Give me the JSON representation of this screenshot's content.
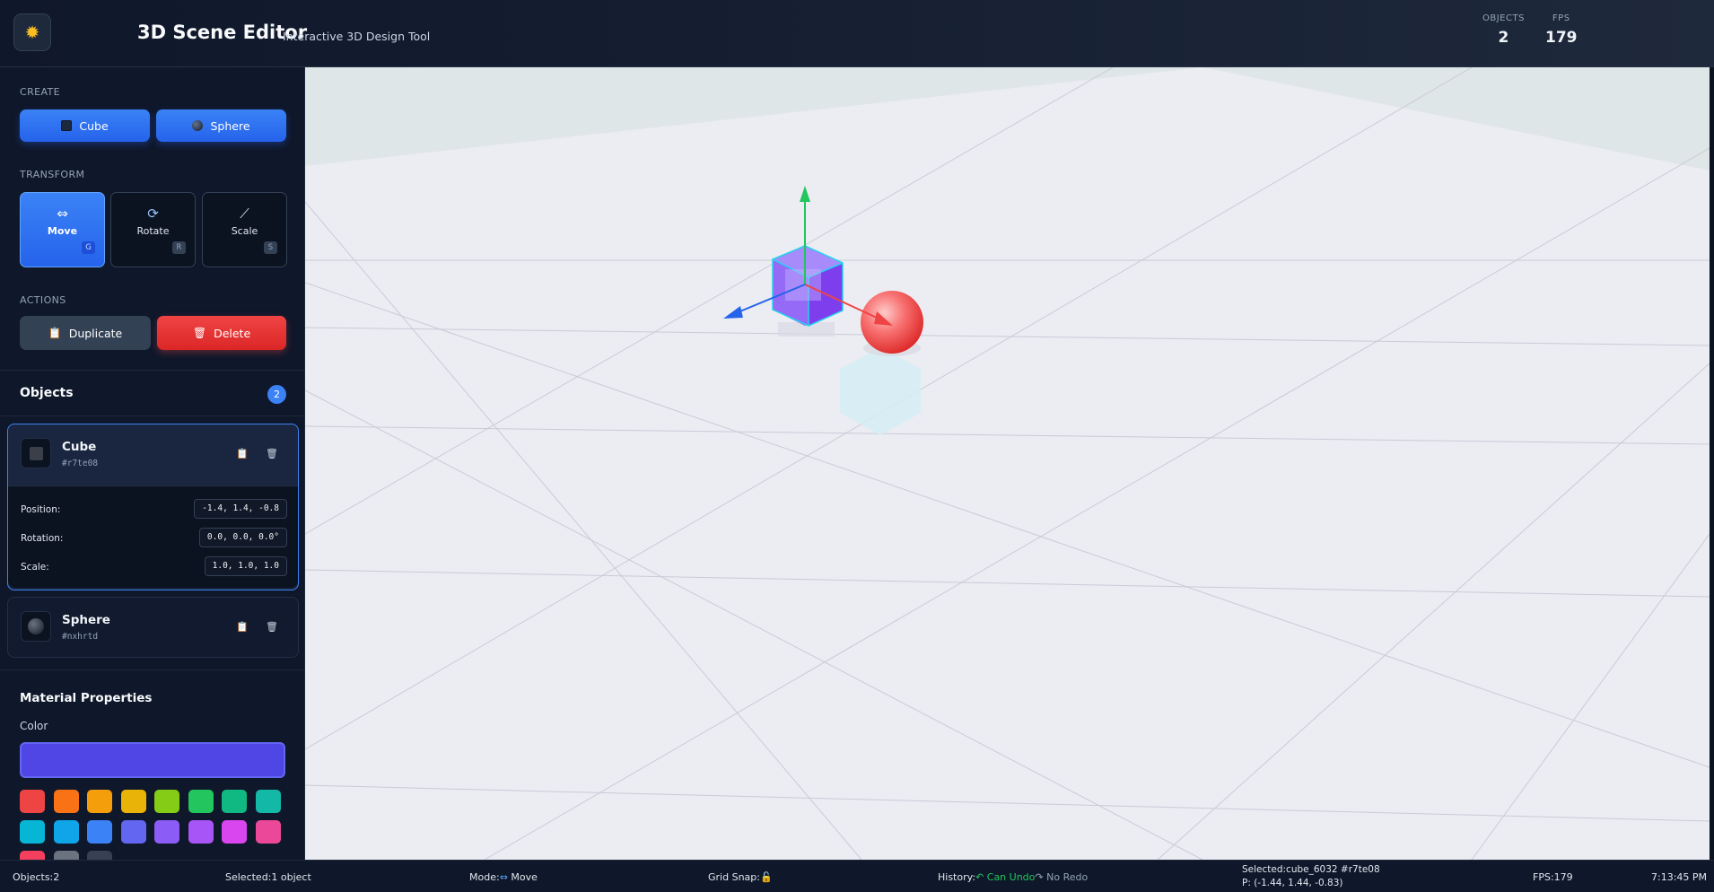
{
  "header": {
    "title": "3D Scene Editor",
    "subtitle": "Interactive 3D Design Tool",
    "logo_icon": "sun-icon",
    "stats": {
      "objects_label": "OBJECTS",
      "objects_value": "2",
      "fps_label": "FPS",
      "fps_value": "179"
    }
  },
  "sidebar": {
    "create_label": "CREATE",
    "create_buttons": {
      "cube": "Cube",
      "sphere": "Sphere"
    },
    "transform_label": "TRANSFORM",
    "tools": [
      {
        "label": "Move",
        "key": "G",
        "icon": "move-icon",
        "active": true
      },
      {
        "label": "Rotate",
        "key": "R",
        "icon": "rotate-icon",
        "active": false
      },
      {
        "label": "Scale",
        "key": "S",
        "icon": "ruler-icon",
        "active": false
      }
    ],
    "actions_label": "ACTIONS",
    "actions": {
      "duplicate": "Duplicate",
      "delete": "Delete"
    },
    "objects_title": "Objects",
    "objects_count": "2",
    "objects": [
      {
        "name": "Cube",
        "id": "#r7te08",
        "selected": true,
        "props": {
          "position_label": "Position:",
          "position": "-1.4, 1.4, -0.8",
          "rotation_label": "Rotation:",
          "rotation": "0.0, 0.0, 0.0°",
          "scale_label": "Scale:",
          "scale": "1.0, 1.0, 1.0"
        }
      },
      {
        "name": "Sphere",
        "id": "#nxhrtd",
        "selected": false
      }
    ],
    "material": {
      "title": "Material Properties",
      "color_label": "Color",
      "current_color": "#4f46e5",
      "swatches": [
        "#ef4444",
        "#f97316",
        "#f59e0b",
        "#eab308",
        "#84cc16",
        "#22c55e",
        "#10b981",
        "#14b8a6",
        "#06b6d4",
        "#0ea5e9",
        "#3b82f6",
        "#6366f1",
        "#8b5cf6",
        "#a855f7",
        "#d946ef",
        "#ec4899",
        "#f43f5e",
        "#6b7280",
        "#374151"
      ]
    }
  },
  "statusbar": {
    "objects": "Objects:2",
    "selected": "Selected:1 object",
    "mode_prefix": "Mode:",
    "mode_value": "Move",
    "grid_snap": "Grid Snap:",
    "history_prefix": "History:",
    "can_undo": "Can Undo",
    "no_redo": "No Redo",
    "selected_detail": "Selected:cube_6032 #r7te08",
    "position_detail": "P: (-1.44, 1.44, -0.83)",
    "fps": "FPS:179",
    "time": "7:13:45 PM"
  },
  "colors": {
    "accent": "#3b82f6",
    "danger": "#ef4444",
    "cube": "#8b5cf6",
    "sphere": "#f87171"
  }
}
